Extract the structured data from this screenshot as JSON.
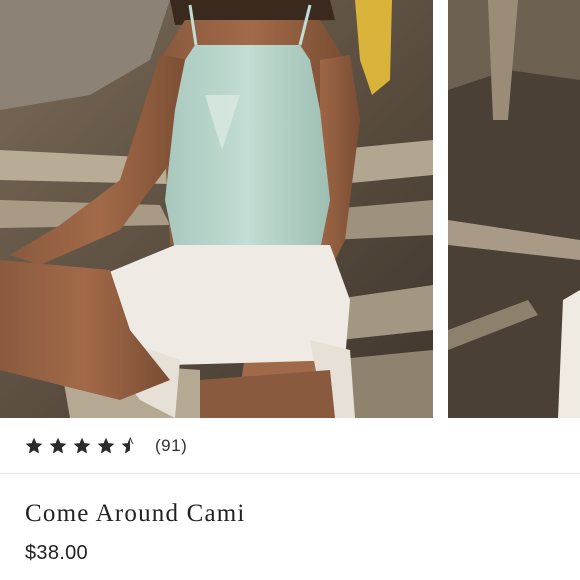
{
  "product": {
    "name": "Come Around Cami",
    "price": "$38.00",
    "rating": 4.5,
    "review_count": "(91)"
  },
  "gallery": {
    "images": [
      {
        "icon": "product-photo-model-cami"
      },
      {
        "icon": "product-photo-next-partial"
      }
    ]
  },
  "colors": {
    "star": "#2b2b2b",
    "top": "#b9d5cb",
    "shorts": "#f0ece6"
  }
}
